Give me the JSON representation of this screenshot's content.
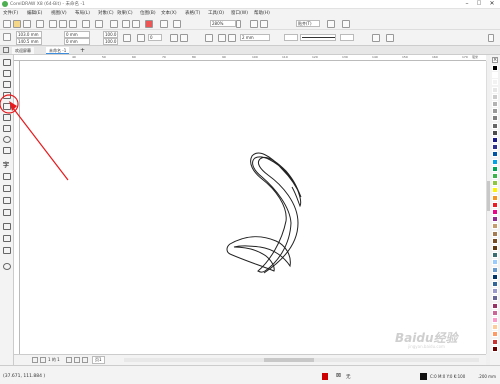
{
  "window": {
    "title": "CorelDRAW X8 (64-Bit) - 未命名 -1"
  },
  "menu": [
    "文件(F)",
    "编辑(E)",
    "视图(V)",
    "布局(L)",
    "对象(C)",
    "效果(C)",
    "位图(B)",
    "文本(X)",
    "表格(T)",
    "工具(O)",
    "窗口(W)",
    "帮助(H)"
  ],
  "standard_toolbar": {
    "zoom": "280%",
    "snap_label": "贴齐(T)"
  },
  "property_bar": {
    "x": "103.0 mm",
    "y": "140.5 mm",
    "width": "0 mm",
    "height": "0 mm",
    "scale_x": "100.0",
    "scale_y": "100.0",
    "angle": "0",
    "outline_width": "2 mm"
  },
  "tabs": {
    "welcome": "欢迎屏幕",
    "document": "未命名 -1"
  },
  "ruler": {
    "unit": "毫米",
    "marks": [
      "40",
      "50",
      "60",
      "70",
      "80",
      "90",
      "100",
      "110",
      "120",
      "130",
      "140",
      "150",
      "160",
      "170",
      "180"
    ]
  },
  "page_nav": {
    "current": "1 的 1",
    "page_tab": "页1"
  },
  "status": {
    "coords": "(37.671, 111.884 )",
    "fill_none": "无",
    "outline_info": "C:0 M:0 Y:0 K:100",
    "outline_width": ".200 mm"
  },
  "watermark": {
    "text": "Baidu经验",
    "sub": "jingyan.baidu.com"
  },
  "colors": {
    "annotation": "#e8191c",
    "palette": [
      "#000000",
      "#ffffff",
      "#f2f2f2",
      "#e6e6e6",
      "#cccccc",
      "#b3b3b3",
      "#999999",
      "#808080",
      "#666666",
      "#4d4d4d",
      "#1a1a8a",
      "#2e3192",
      "#0054a6",
      "#00a2e8",
      "#00a651",
      "#39b54a",
      "#8dc63f",
      "#fff200",
      "#f7941d",
      "#ed1c24",
      "#ec008c",
      "#92278f",
      "#c69c6d",
      "#a67c52",
      "#754c24",
      "#603913",
      "#3c6e71",
      "#99ccff",
      "#6699cc",
      "#003366",
      "#336699",
      "#9999cc",
      "#666699",
      "#993366",
      "#cc6699",
      "#ff99cc",
      "#ffcc99",
      "#ff9966",
      "#cc3333",
      "#660000"
    ]
  }
}
